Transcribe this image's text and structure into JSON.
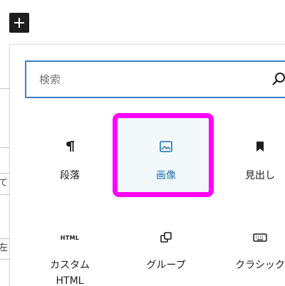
{
  "toolbar": {
    "inserter_icon": "plus-icon"
  },
  "background": {
    "fragments": [
      "て",
      "左"
    ]
  },
  "search": {
    "placeholder": "検索",
    "value": "",
    "icon": "search-icon"
  },
  "blocks": [
    {
      "label": "段落",
      "icon": "paragraph-icon",
      "selected": false
    },
    {
      "label": "画像",
      "icon": "image-icon",
      "selected": true
    },
    {
      "label": "見出し",
      "icon": "heading-icon",
      "selected": false
    },
    {
      "label_line1": "カスタム",
      "label_line2": "HTML",
      "icon": "html-icon",
      "icon_text": "HTML",
      "selected": false
    },
    {
      "label": "グループ",
      "icon": "group-icon",
      "selected": false
    },
    {
      "label": "クラシック",
      "icon": "classic-keyboard-icon",
      "selected": false
    }
  ],
  "colors": {
    "accent": "#2271b1",
    "highlight": "#ff00ff",
    "focus_border": "#3582c4",
    "dark": "#1e1e1e"
  }
}
